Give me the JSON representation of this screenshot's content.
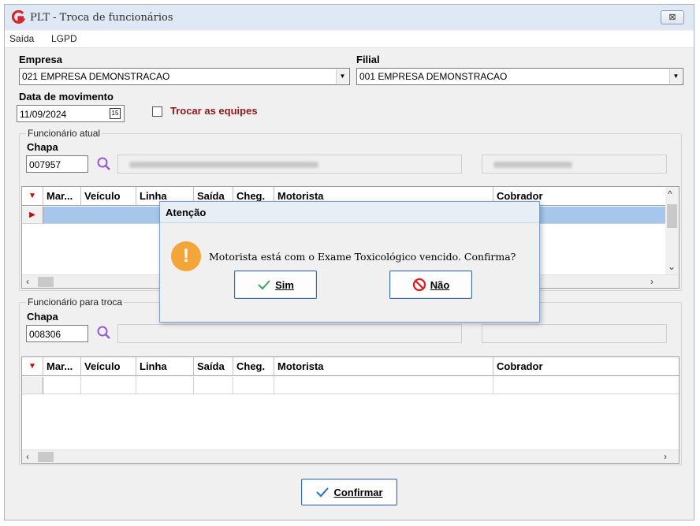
{
  "window": {
    "title": "PLT - Troca de funcionários",
    "close_glyph": "⊠"
  },
  "menu": {
    "items": [
      "Saída",
      "LGPD"
    ]
  },
  "empresa": {
    "label": "Empresa",
    "value": "021 EMPRESA DEMONSTRACAO"
  },
  "filial": {
    "label": "Filial",
    "value": "001 EMPRESA DEMONSTRACAO"
  },
  "data_movimento": {
    "label": "Data de movimento",
    "value": "11/09/2024"
  },
  "trocar_equipes": {
    "label": "Trocar as equipes",
    "checked": false
  },
  "funcionario_atual": {
    "group_title": "Funcionário atual",
    "chapa_label": "Chapa",
    "chapa_value": "007957"
  },
  "funcionario_troca": {
    "group_title": "Funcionário para troca",
    "chapa_label": "Chapa",
    "chapa_value": "008306"
  },
  "grid_columns": [
    "Mar...",
    "Veículo",
    "Linha",
    "Saída",
    "Cheg.",
    "Motorista",
    "Cobrador"
  ],
  "grid_top_partial_columns": [
    "Mar...",
    "Veículo",
    "Linha",
    "Saída",
    "Cheg.",
    "Motorista",
    "Cobrador"
  ],
  "confirm_button": {
    "label": "Confirmar"
  },
  "dialog": {
    "title": "Atenção",
    "message": "Motorista está com o Exame Toxicológico vencido. Confirma?",
    "yes_label": "Sim",
    "no_label": "Não"
  },
  "colors": {
    "selected_row": "#a7c6ec",
    "accent_red": "#d10000",
    "warning": "#f4a53a",
    "link_blue": "#3a6ea5"
  }
}
